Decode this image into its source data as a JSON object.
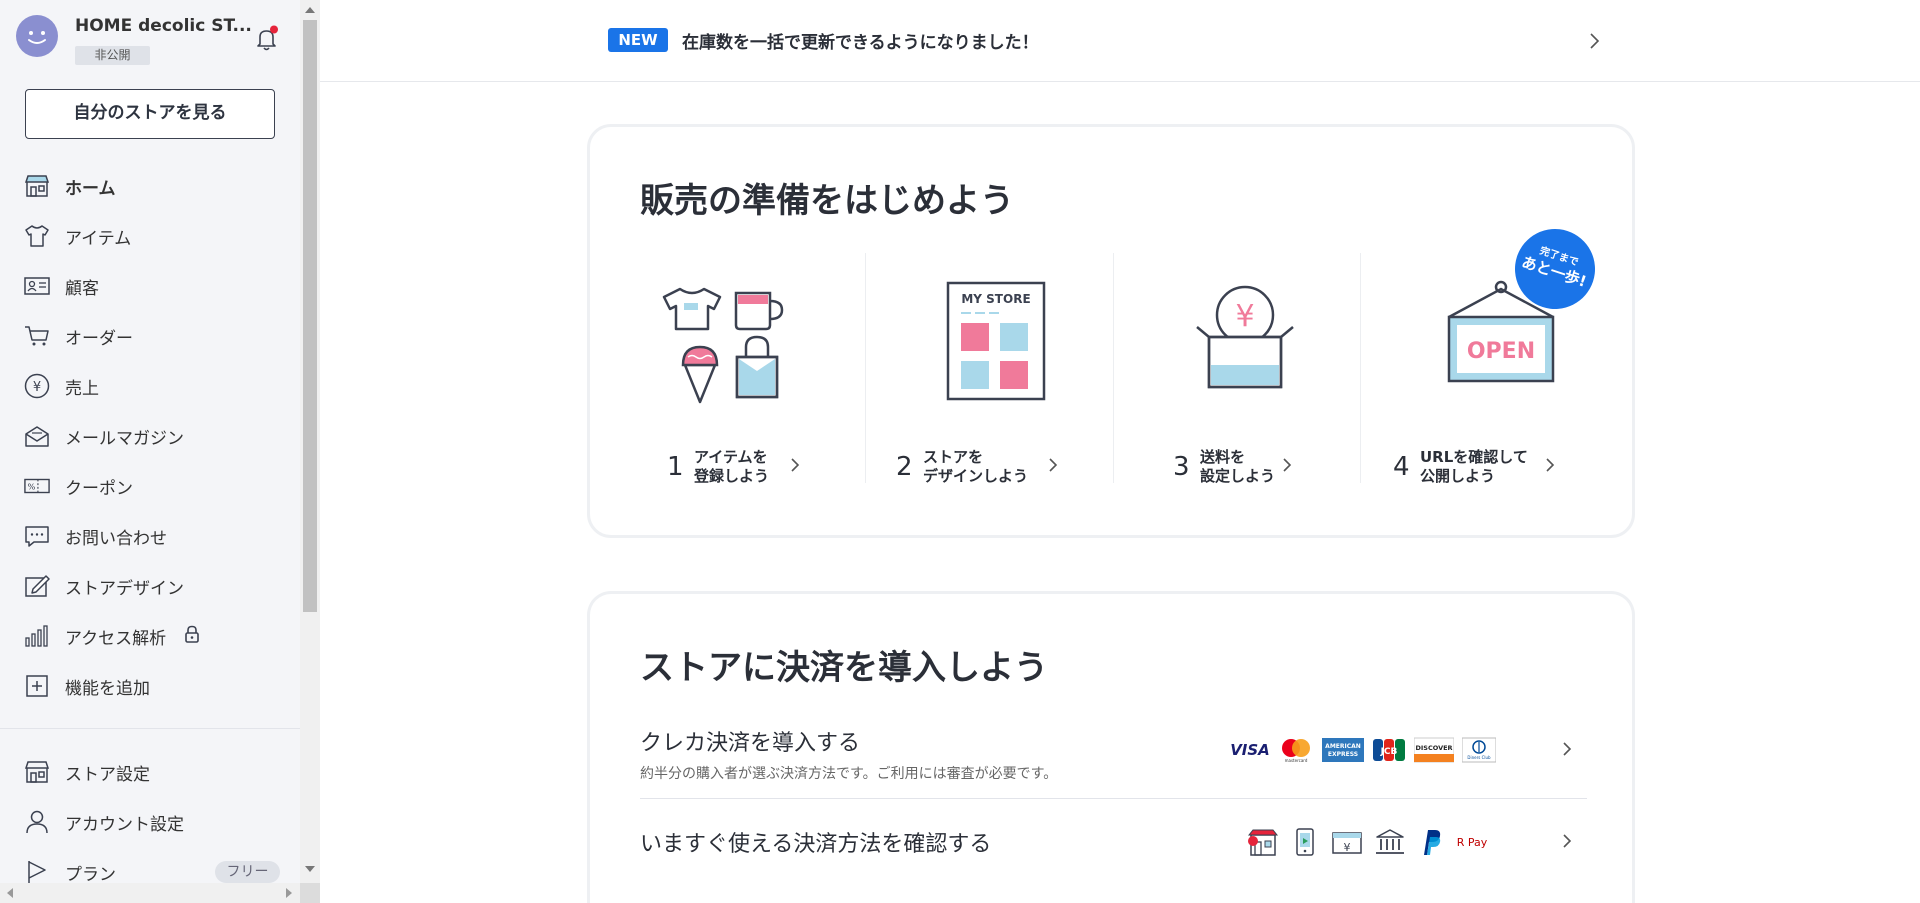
{
  "sidebar": {
    "store_name": "HOME decolic ST...",
    "visibility_badge": "非公開",
    "view_store_button": "自分のストアを見る",
    "nav_items": [
      {
        "label": "ホーム",
        "icon": "shop-icon",
        "active": true
      },
      {
        "label": "アイテム",
        "icon": "tshirt-icon"
      },
      {
        "label": "顧客",
        "icon": "id-card-icon"
      },
      {
        "label": "オーダー",
        "icon": "cart-icon"
      },
      {
        "label": "売上",
        "icon": "yen-icon"
      },
      {
        "label": "メールマガジン",
        "icon": "mail-icon"
      },
      {
        "label": "クーポン",
        "icon": "coupon-icon"
      },
      {
        "label": "お問い合わせ",
        "icon": "chat-icon"
      },
      {
        "label": "ストアデザイン",
        "icon": "pen-icon"
      },
      {
        "label": "アクセス解析",
        "icon": "bar-chart-icon",
        "locked": true
      },
      {
        "label": "機能を追加",
        "icon": "plus-box-icon"
      }
    ],
    "bottom_items": [
      {
        "label": "ストア設定",
        "icon": "shop-icon"
      },
      {
        "label": "アカウント設定",
        "icon": "user-icon"
      },
      {
        "label": "プラン",
        "icon": "flag-icon",
        "pill": "フリー"
      }
    ]
  },
  "news": {
    "tag": "NEW",
    "text": "在庫数を一括で更新できるようになりました！"
  },
  "setup_card": {
    "title": "販売の準備をはじめよう",
    "done_badge_small": "完了まで",
    "done_badge_big": "あと一歩!",
    "steps": [
      {
        "num": "1",
        "line1": "アイテムを",
        "line2": "登録しよう"
      },
      {
        "num": "2",
        "line1": "ストアを",
        "line2": "デザインしよう",
        "illustration_text": "MY STORE"
      },
      {
        "num": "3",
        "line1": "送料を",
        "line2": "設定しよう",
        "illustration_text": "¥"
      },
      {
        "num": "4",
        "line1": "URLを確認して",
        "line2": "公開しよう",
        "illustration_text": "OPEN"
      }
    ]
  },
  "payment_card": {
    "title": "ストアに決済を導入しよう",
    "credit": {
      "title": "クレカ決済を導入する",
      "desc": "約半分の購入者が選ぶ決済方法です。ご利用には審査が必要です。",
      "logos": [
        "VISA",
        "mastercard",
        "AMERICAN EXPRESS",
        "JCB",
        "DISCOVER",
        "Diners Club"
      ]
    },
    "others": {
      "title": "いますぐ使える決済方法を確認する",
      "logos": [
        "store-icon",
        "phone-icon",
        "card-icon",
        "bank-icon",
        "paypal-icon",
        "R Pay"
      ]
    }
  },
  "colors": {
    "accent": "#1a74e8",
    "pink": "#f07a9a",
    "light_blue": "#a9d8ea",
    "dark": "#3b4150",
    "notification_dot": "#e5243b"
  }
}
